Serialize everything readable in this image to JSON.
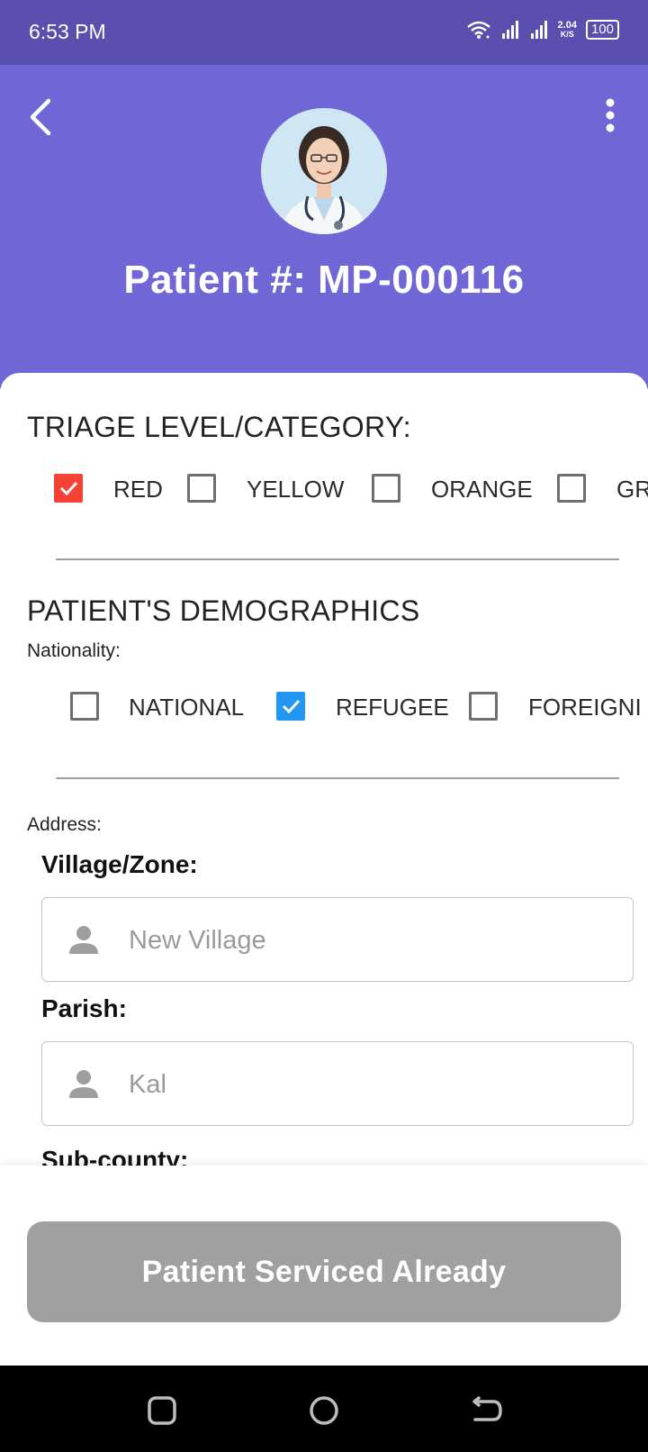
{
  "status_bar": {
    "time": "6:53 PM",
    "net_speed_value": "2.04",
    "net_speed_unit": "K/S",
    "battery": "100"
  },
  "header": {
    "patient_title": "Patient #:  MP-000116",
    "background_color": "#7066d6"
  },
  "triage": {
    "heading": "TRIAGE LEVEL/CATEGORY:",
    "options": [
      {
        "label": "RED",
        "checked": true
      },
      {
        "label": "YELLOW",
        "checked": false
      },
      {
        "label": "ORANGE",
        "checked": false
      },
      {
        "label": "GR",
        "checked": false
      }
    ]
  },
  "demographics": {
    "heading": "PATIENT'S DEMOGRAPHICS",
    "nationality_label": "Nationality:",
    "nationality_options": [
      {
        "label": "NATIONAL",
        "checked": false
      },
      {
        "label": "REFUGEE",
        "checked": true
      },
      {
        "label": "FOREIGNI",
        "checked": false
      }
    ]
  },
  "address": {
    "label": "Address:",
    "village_label": "Village/Zone:",
    "village_value": "New Village",
    "parish_label": "Parish:",
    "parish_value": "Kal",
    "subcounty_label": "Sub-county:"
  },
  "actions": {
    "serviced_label": "Patient Serviced Already"
  },
  "icons": {
    "back": "arrow-back-icon",
    "more": "more-vert-icon",
    "person": "person-icon"
  }
}
